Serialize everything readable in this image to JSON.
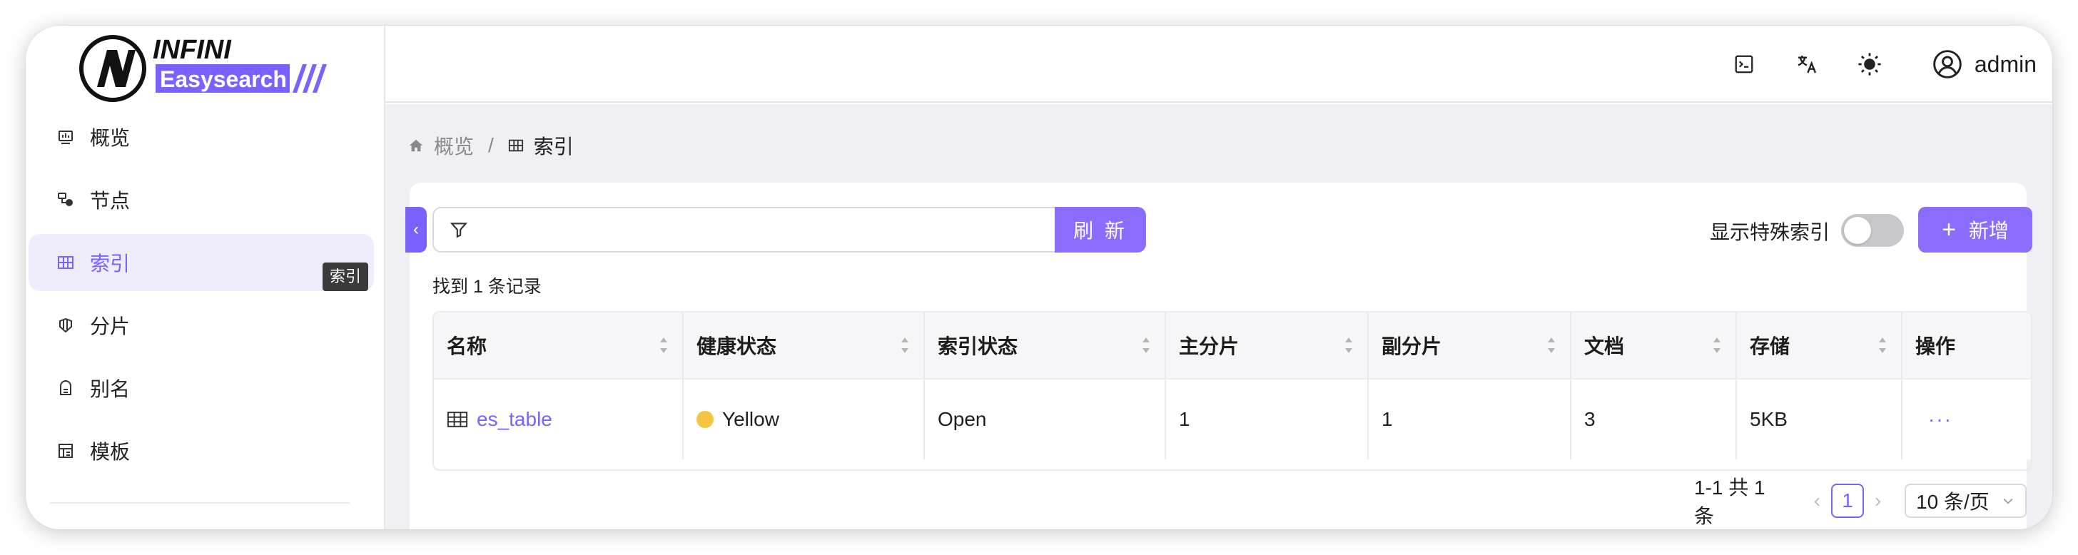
{
  "brand": {
    "name_top": "INFINI",
    "name_bottom": "Easysearch",
    "accent": "#7b61ff"
  },
  "sidebar": {
    "items": [
      {
        "label": "概览",
        "icon": "dashboard-icon",
        "active": false
      },
      {
        "label": "节点",
        "icon": "node-icon",
        "active": false
      },
      {
        "label": "索引",
        "icon": "table-icon",
        "active": true
      },
      {
        "label": "分片",
        "icon": "shards-icon",
        "active": false
      },
      {
        "label": "别名",
        "icon": "alias-icon",
        "active": false
      },
      {
        "label": "模板",
        "icon": "template-icon",
        "active": false
      }
    ],
    "tooltip": "索引"
  },
  "header": {
    "icons": [
      "terminal-icon",
      "translate-icon",
      "theme-sun-icon"
    ],
    "user": "admin"
  },
  "breadcrumb": {
    "home": "概览",
    "separator": "/",
    "current": "索引"
  },
  "toolbar": {
    "search_value": "",
    "refresh_label": "刷 新",
    "special_label": "显示特殊索引",
    "special_enabled": false,
    "add_label": "新增"
  },
  "result_count": "找到 1 条记录",
  "table": {
    "columns": [
      "名称",
      "健康状态",
      "索引状态",
      "主分片",
      "副分片",
      "文档",
      "存储",
      "操作"
    ],
    "rows": [
      {
        "name": "es_table",
        "health": "Yellow",
        "health_color": "#f5c540",
        "status": "Open",
        "primary": "1",
        "replica": "1",
        "docs": "3",
        "storage": "5KB",
        "action": "···"
      }
    ]
  },
  "pagination": {
    "summary": "1-1 共 1 条",
    "current": "1",
    "page_size": "10 条/页"
  }
}
